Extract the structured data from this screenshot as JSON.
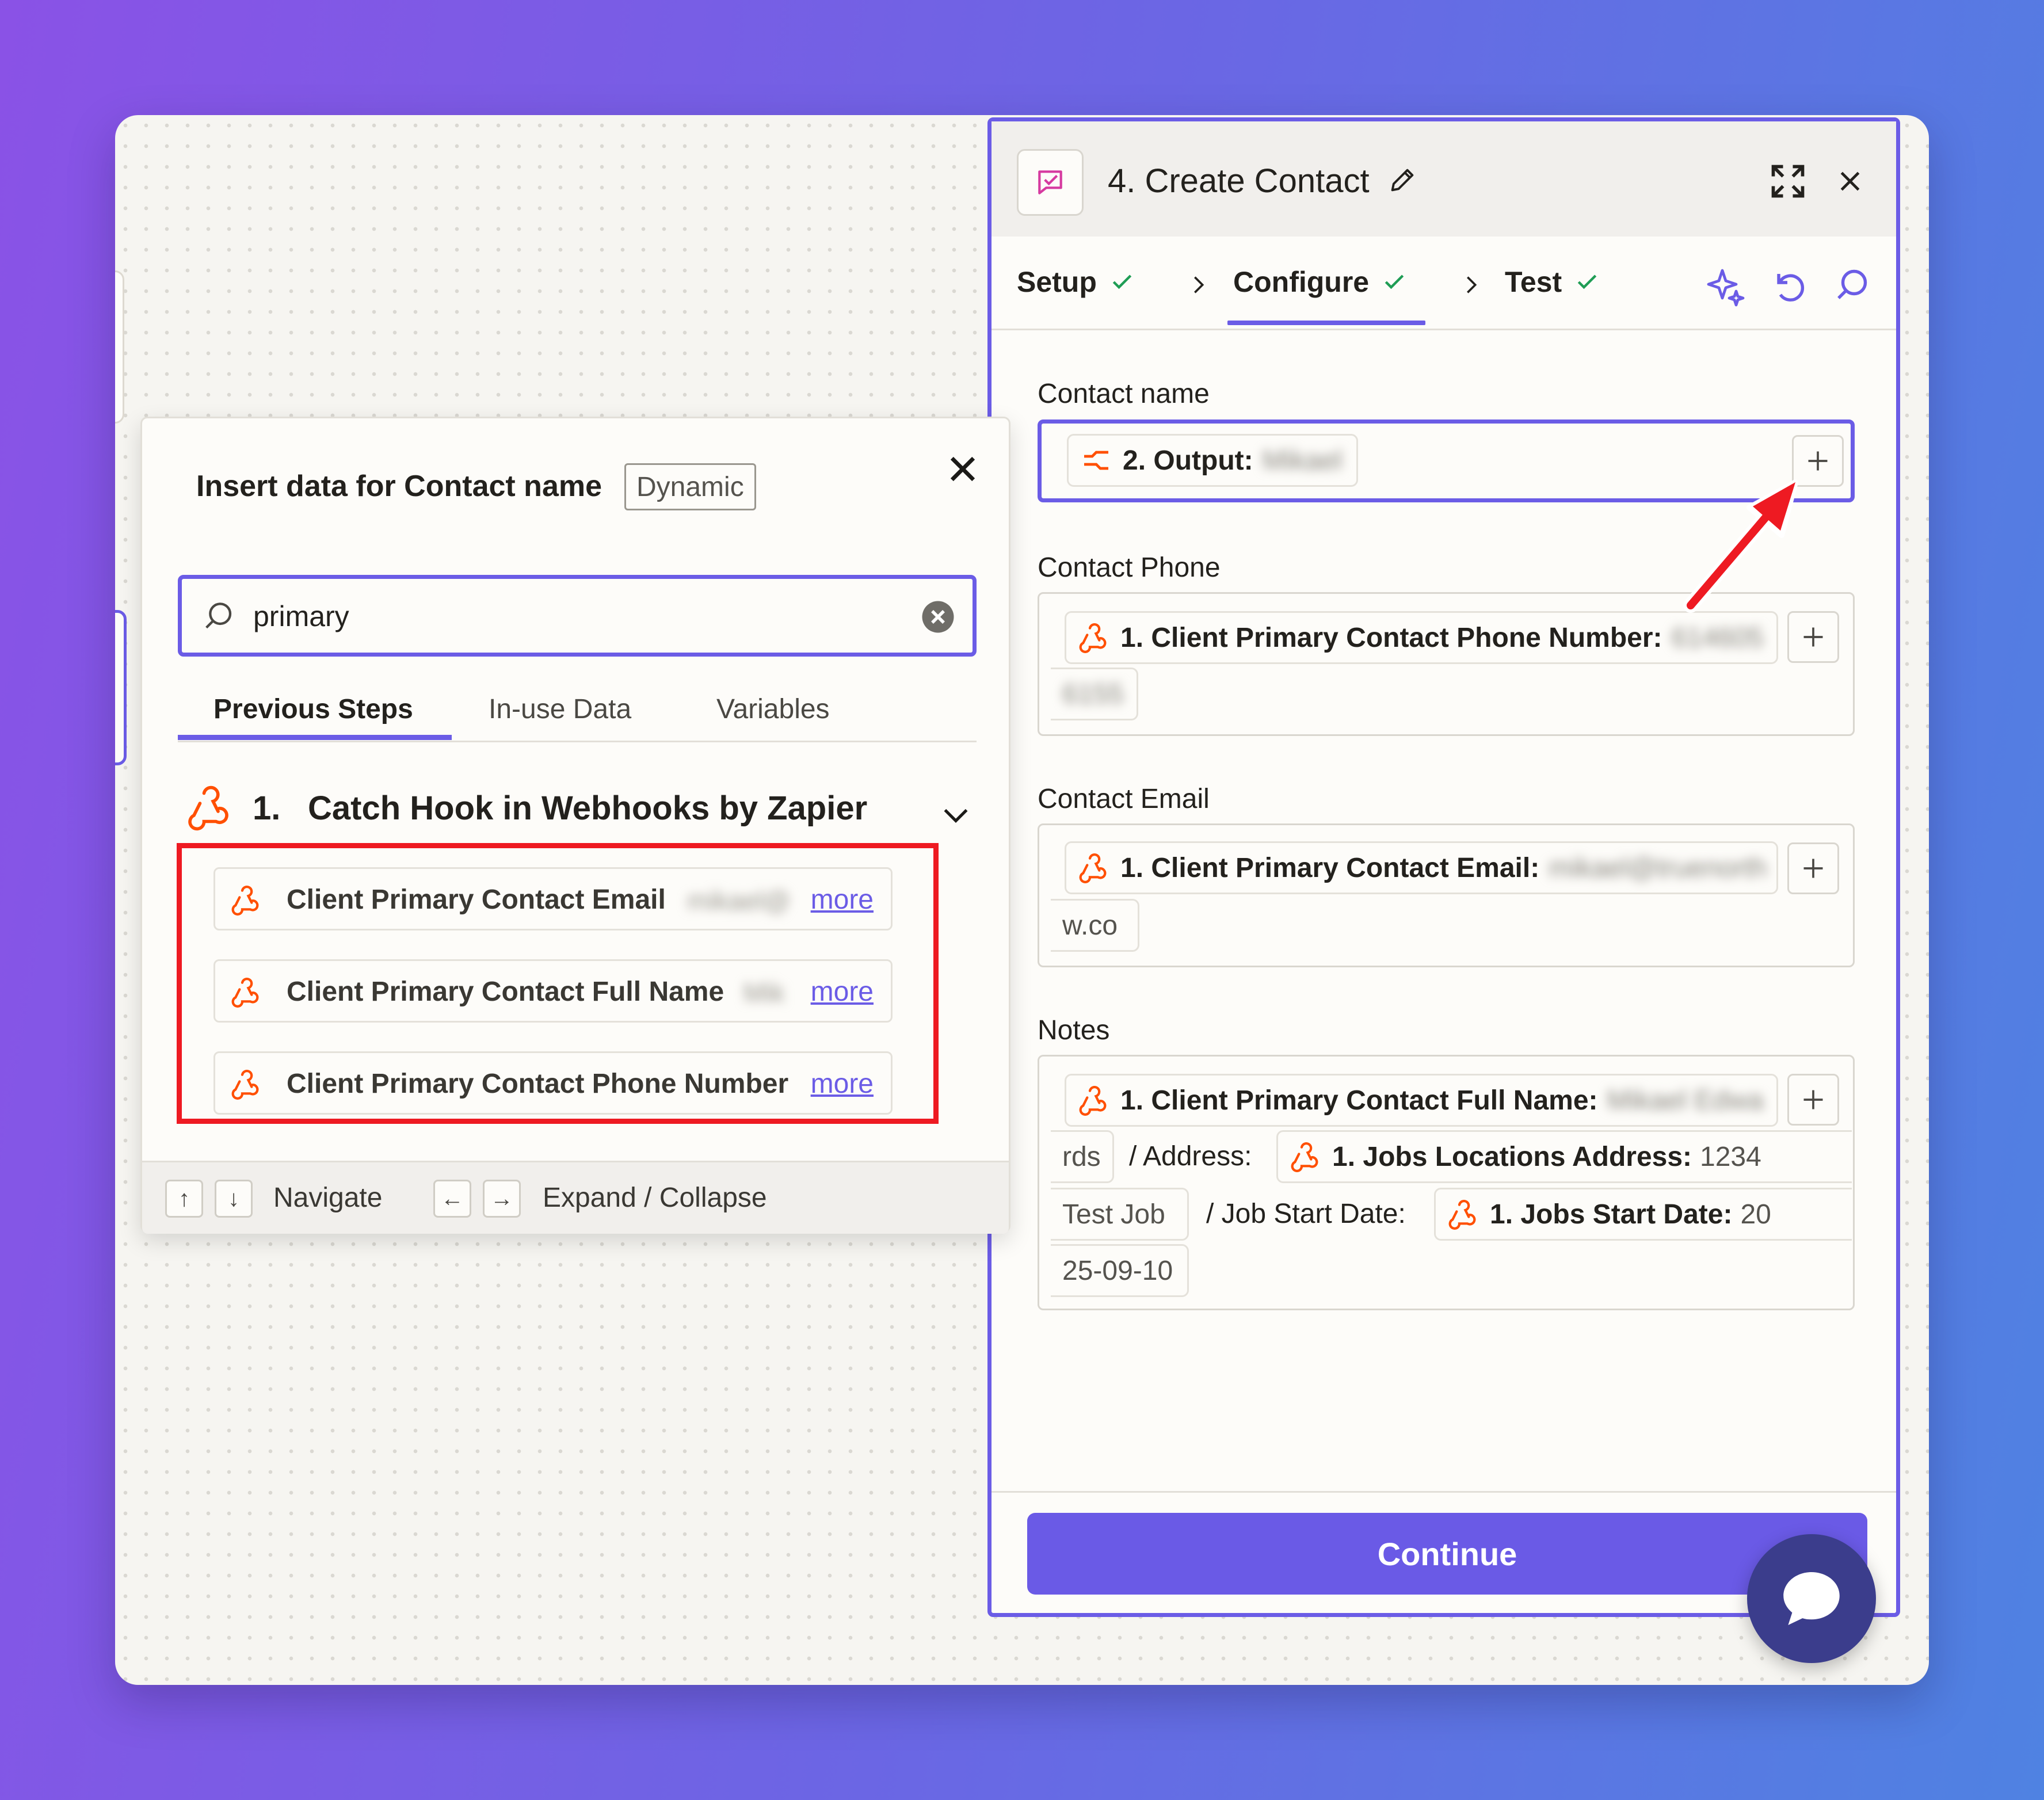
{
  "panel": {
    "title": "4. Create Contact",
    "steps": [
      {
        "label": "Setup",
        "done": true
      },
      {
        "label": "Configure",
        "done": true,
        "active": true
      },
      {
        "label": "Test",
        "done": true
      }
    ],
    "fields": {
      "contact_name": {
        "label": "Contact name",
        "pill_label": "2. Output:",
        "pill_value_blurred": "Mikael"
      },
      "contact_phone": {
        "label": "Contact Phone",
        "pill_label": "1. Client Primary Contact Phone Number:",
        "pill_value_blurred": "614605",
        "overflow_blurred": "6155"
      },
      "contact_email": {
        "label": "Contact Email",
        "pill_label": "1. Client Primary Contact Email:",
        "pill_value_blurred": "mikael@truenorth",
        "overflow_value": "w.co"
      },
      "notes": {
        "label": "Notes",
        "pill1_label": "1. Client Primary Contact Full Name:",
        "pill1_value_blurred": "Mikael Edwa",
        "pill1_overflow": "rds",
        "text1": "/ Address:",
        "pill2_label": "1. Jobs Locations Address:",
        "pill2_value": "1234",
        "pill2_overflow": "Test Job",
        "text2": "/ Job Start Date:",
        "pill3_label": "1. Jobs Start Date:",
        "pill3_value": "20",
        "pill3_overflow": "25-09-10"
      }
    },
    "continue_label": "Continue"
  },
  "popup": {
    "title": "Insert data for Contact name",
    "badge": "Dynamic",
    "search_value": "primary",
    "tabs": [
      "Previous Steps",
      "In-use Data",
      "Variables"
    ],
    "group_number": "1.",
    "group_title": "Catch Hook in Webhooks by Zapier",
    "items": [
      {
        "label": "Client Primary Contact Email",
        "preview_blurred": "mikael@",
        "more": "more"
      },
      {
        "label": "Client Primary Contact Full Name",
        "preview_blurred": "Mik",
        "more": "more"
      },
      {
        "label": "Client Primary Contact Phone Number",
        "preview_blurred": "",
        "more": "more"
      }
    ],
    "footer": {
      "up_key": "↑",
      "down_key": "↓",
      "navigate": "Navigate",
      "left_key": "←",
      "right_key": "→",
      "expand_collapse": "Expand / Collapse"
    }
  },
  "colors": {
    "accent": "#6b5ce6",
    "webhook_icon": "#ff4f00",
    "highlight_box": "#ee1a22",
    "check": "#1f9d55"
  },
  "icons": [
    "app-icon",
    "edit-icon",
    "expand-icon",
    "close-icon",
    "check-icon",
    "chevron-right-icon",
    "ai-sparkle-icon",
    "undo-icon",
    "search-icon",
    "plus-icon",
    "webhook-icon",
    "formatter-icon",
    "clear-icon",
    "chevron-down-icon",
    "chat-icon",
    "red-arrow-annotation"
  ]
}
